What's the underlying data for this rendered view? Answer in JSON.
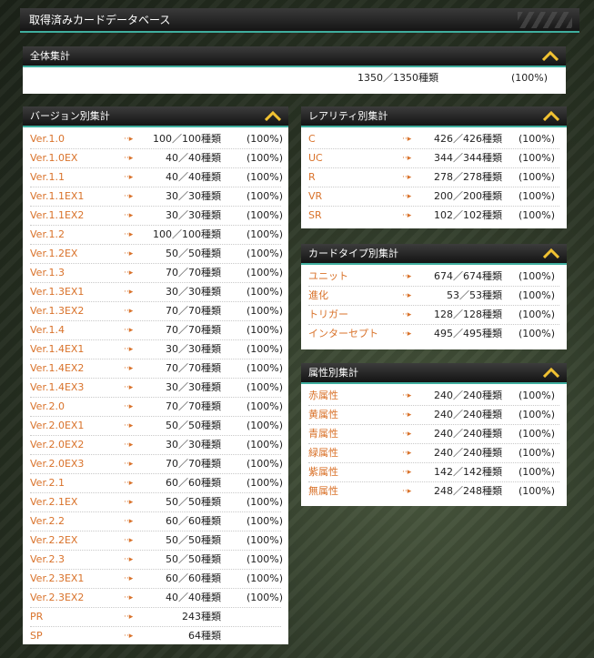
{
  "page_title": "取得済みカードデータベース",
  "overall": {
    "title": "全体集計",
    "count": "1350／1350種類",
    "pct": "(100%)"
  },
  "version": {
    "title": "バージョン別集計",
    "rows": [
      {
        "name": "Ver.1.0",
        "count": "100／100種類",
        "pct": "(100%)"
      },
      {
        "name": "Ver.1.0EX",
        "count": "40／40種類",
        "pct": "(100%)"
      },
      {
        "name": "Ver.1.1",
        "count": "40／40種類",
        "pct": "(100%)"
      },
      {
        "name": "Ver.1.1EX1",
        "count": "30／30種類",
        "pct": "(100%)"
      },
      {
        "name": "Ver.1.1EX2",
        "count": "30／30種類",
        "pct": "(100%)"
      },
      {
        "name": "Ver.1.2",
        "count": "100／100種類",
        "pct": "(100%)"
      },
      {
        "name": "Ver.1.2EX",
        "count": "50／50種類",
        "pct": "(100%)"
      },
      {
        "name": "Ver.1.3",
        "count": "70／70種類",
        "pct": "(100%)"
      },
      {
        "name": "Ver.1.3EX1",
        "count": "30／30種類",
        "pct": "(100%)"
      },
      {
        "name": "Ver.1.3EX2",
        "count": "70／70種類",
        "pct": "(100%)"
      },
      {
        "name": "Ver.1.4",
        "count": "70／70種類",
        "pct": "(100%)"
      },
      {
        "name": "Ver.1.4EX1",
        "count": "30／30種類",
        "pct": "(100%)"
      },
      {
        "name": "Ver.1.4EX2",
        "count": "70／70種類",
        "pct": "(100%)"
      },
      {
        "name": "Ver.1.4EX3",
        "count": "30／30種類",
        "pct": "(100%)"
      },
      {
        "name": "Ver.2.0",
        "count": "70／70種類",
        "pct": "(100%)"
      },
      {
        "name": "Ver.2.0EX1",
        "count": "50／50種類",
        "pct": "(100%)"
      },
      {
        "name": "Ver.2.0EX2",
        "count": "30／30種類",
        "pct": "(100%)"
      },
      {
        "name": "Ver.2.0EX3",
        "count": "70／70種類",
        "pct": "(100%)"
      },
      {
        "name": "Ver.2.1",
        "count": "60／60種類",
        "pct": "(100%)"
      },
      {
        "name": "Ver.2.1EX",
        "count": "50／50種類",
        "pct": "(100%)"
      },
      {
        "name": "Ver.2.2",
        "count": "60／60種類",
        "pct": "(100%)"
      },
      {
        "name": "Ver.2.2EX",
        "count": "50／50種類",
        "pct": "(100%)"
      },
      {
        "name": "Ver.2.3",
        "count": "50／50種類",
        "pct": "(100%)"
      },
      {
        "name": "Ver.2.3EX1",
        "count": "60／60種類",
        "pct": "(100%)"
      },
      {
        "name": "Ver.2.3EX2",
        "count": "40／40種類",
        "pct": "(100%)"
      },
      {
        "name": "PR",
        "count": "243種類",
        "pct": ""
      },
      {
        "name": "SP",
        "count": "64種類",
        "pct": ""
      }
    ]
  },
  "rarity": {
    "title": "レアリティ別集計",
    "rows": [
      {
        "name": "C",
        "count": "426／426種類",
        "pct": "(100%)"
      },
      {
        "name": "UC",
        "count": "344／344種類",
        "pct": "(100%)"
      },
      {
        "name": "R",
        "count": "278／278種類",
        "pct": "(100%)"
      },
      {
        "name": "VR",
        "count": "200／200種類",
        "pct": "(100%)"
      },
      {
        "name": "SR",
        "count": "102／102種類",
        "pct": "(100%)"
      }
    ]
  },
  "cardtype": {
    "title": "カードタイプ別集計",
    "rows": [
      {
        "name": "ユニット",
        "count": "674／674種類",
        "pct": "(100%)"
      },
      {
        "name": "進化",
        "count": "53／53種類",
        "pct": "(100%)"
      },
      {
        "name": "トリガー",
        "count": "128／128種類",
        "pct": "(100%)"
      },
      {
        "name": "インターセプト",
        "count": "495／495種類",
        "pct": "(100%)"
      }
    ]
  },
  "attribute": {
    "title": "属性別集計",
    "rows": [
      {
        "name": "赤属性",
        "count": "240／240種類",
        "pct": "(100%)"
      },
      {
        "name": "黄属性",
        "count": "240／240種類",
        "pct": "(100%)"
      },
      {
        "name": "青属性",
        "count": "240／240種類",
        "pct": "(100%)"
      },
      {
        "name": "緑属性",
        "count": "240／240種類",
        "pct": "(100%)"
      },
      {
        "name": "紫属性",
        "count": "142／142種類",
        "pct": "(100%)"
      },
      {
        "name": "無属性",
        "count": "248／248種類",
        "pct": "(100%)"
      }
    ]
  },
  "colors": {
    "accent": "#3fae9e",
    "label": "#d9722a",
    "toggle": "#f1c232"
  },
  "icons": {
    "toggle": "collapse-chevron-icon",
    "row_arrow": "dotted-arrow-icon"
  }
}
